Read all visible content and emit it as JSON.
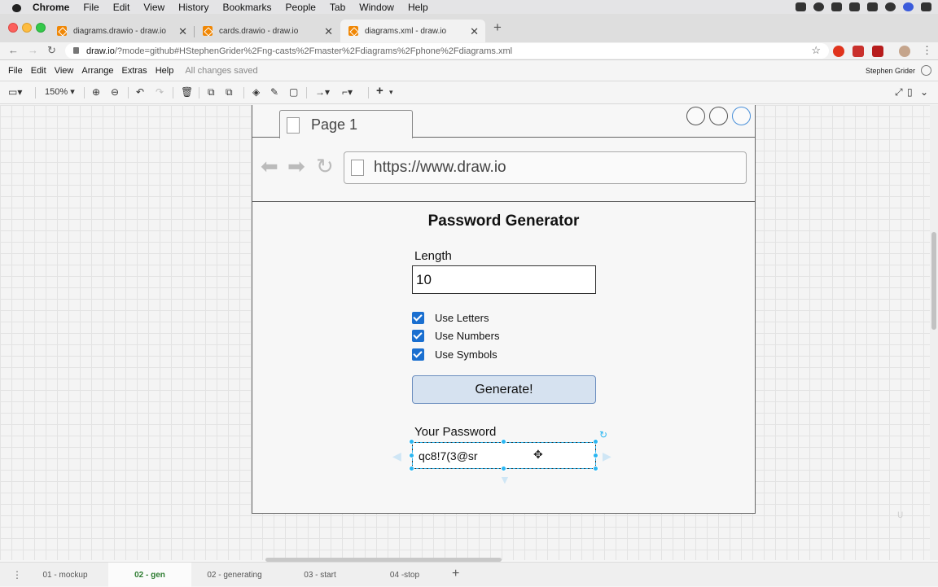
{
  "mac_menubar": {
    "app": "Chrome",
    "items": [
      "File",
      "Edit",
      "View",
      "History",
      "Bookmarks",
      "People",
      "Tab",
      "Window",
      "Help"
    ]
  },
  "browser": {
    "tabs": [
      {
        "title": "diagrams.drawio - draw.io"
      },
      {
        "title": "cards.drawio - draw.io"
      },
      {
        "title": "diagrams.xml - draw.io"
      }
    ],
    "url_domain": "draw.io",
    "url_path": "/?mode=github#HStephenGrider%2Fng-casts%2Fmaster%2Fdiagrams%2Fphone%2Fdiagrams.xml"
  },
  "app_menu": {
    "items": [
      "File",
      "Edit",
      "View",
      "Arrange",
      "Extras",
      "Help"
    ],
    "saved_status": "All changes saved",
    "user": "Stephen Grider"
  },
  "toolbar": {
    "zoom": "150%"
  },
  "mockup": {
    "page_tab": "Page 1",
    "address": "https://www.draw.io",
    "title": "Password Generator",
    "length_label": "Length",
    "length_value": "10",
    "options": [
      {
        "label": "Use Letters",
        "checked": true
      },
      {
        "label": "Use Numbers",
        "checked": true
      },
      {
        "label": "Use Symbols",
        "checked": true
      }
    ],
    "button_label": "Generate!",
    "password_label": "Your Password",
    "password_value": "qc8!7(3@sr"
  },
  "page_tabs": [
    "01 - mockup",
    "02 - gen",
    "02 - generating",
    "03 - start",
    "04 -stop"
  ],
  "active_page_tab": "02 - gen",
  "colors": {
    "accent": "#1a6fd0",
    "selection": "#29b6f2",
    "button_fill": "#d6e2f0",
    "button_border": "#6c8ebf",
    "active_page_tab": "#2e7d32"
  }
}
